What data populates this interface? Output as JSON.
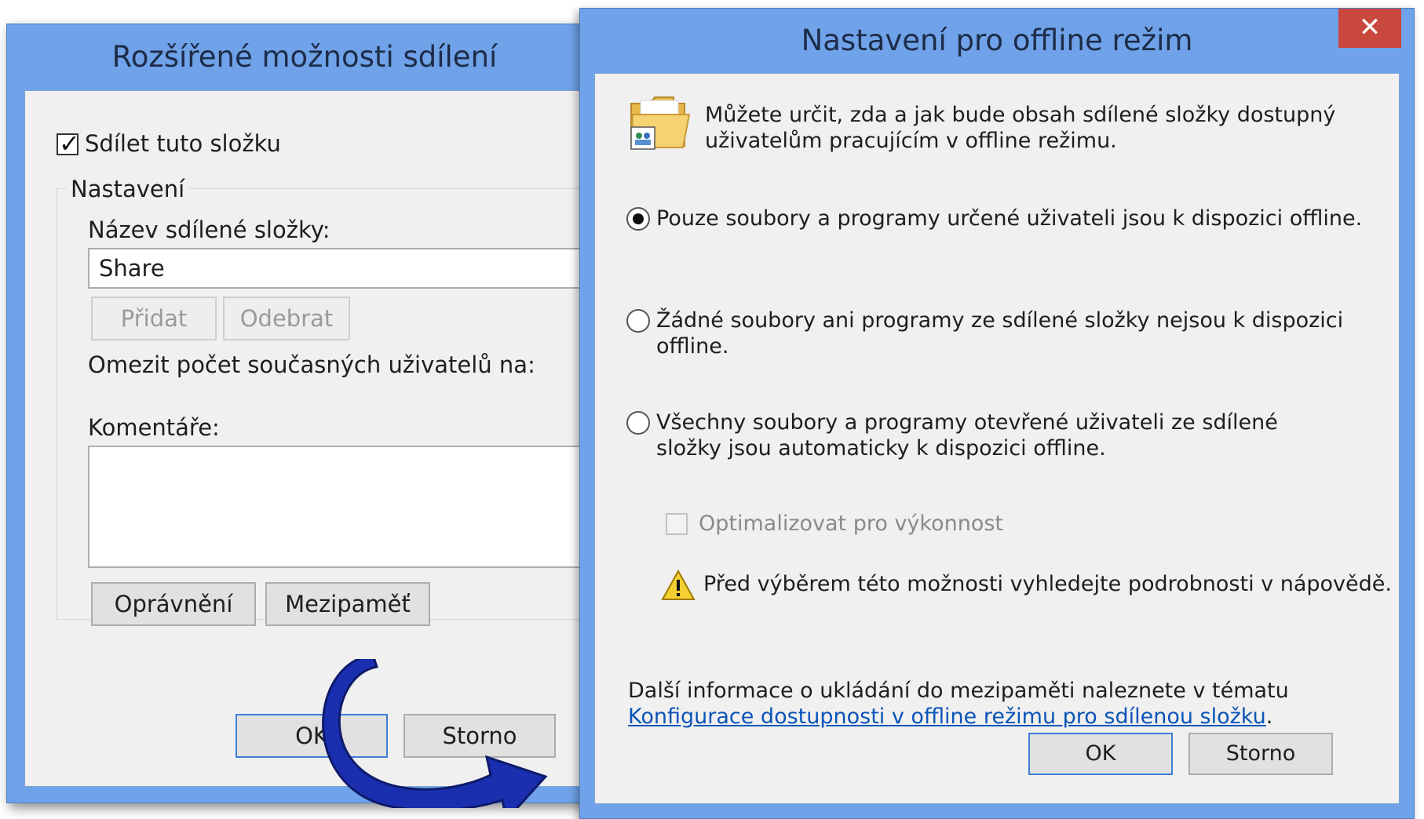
{
  "back_dialog": {
    "title": "Rozšířené možnosti sdílení",
    "share_checkbox_label": "Sdílet tuto složku",
    "share_checked": true,
    "settings_group_label": "Nastavení",
    "share_name_label": "Název sdílené složky:",
    "share_name_value": "Share",
    "add_button": "Přidat",
    "remove_button": "Odebrat",
    "limit_users_label": "Omezit počet současných uživatelů na:",
    "comments_label": "Komentáře:",
    "comments_value": "",
    "permissions_button": "Oprávnění",
    "caching_button": "Mezipaměť",
    "ok_button": "OK",
    "cancel_button": "Storno"
  },
  "front_dialog": {
    "title": "Nastavení pro offline režim",
    "close_glyph": "✕",
    "description": "Můžete určit, zda a jak bude obsah sdílené složky dostupný uživatelům pracujícím v offline režimu.",
    "options": [
      {
        "label": "Pouze soubory a programy určené uživateli jsou k dispozici offline.",
        "selected": true
      },
      {
        "label": "Žádné soubory ani programy ze sdílené složky nejsou k dispozici offline.",
        "selected": false
      },
      {
        "label": "Všechny soubory a programy otevřené uživateli ze sdílené složky jsou automaticky k dispozici offline.",
        "selected": false
      }
    ],
    "optimize_label": "Optimalizovat pro výkonnost",
    "optimize_checked": false,
    "warning_text": "Před výběrem této možnosti vyhledejte podrobnosti v nápovědě.",
    "info_text": "Další informace o ukládání do mezipaměti naleznete v tématu",
    "info_link": "Konfigurace dostupnosti v offline režimu pro sdílenou složku",
    "info_suffix": ".",
    "ok_button": "OK",
    "cancel_button": "Storno"
  },
  "colors": {
    "title_bar": "#6fa2e8",
    "close_button": "#c9483e",
    "link": "#0a54b8",
    "arrow": "#1a2fb0"
  },
  "icons": [
    "shared-folder-icon",
    "warning-icon",
    "close-icon",
    "checkmark-icon"
  ]
}
